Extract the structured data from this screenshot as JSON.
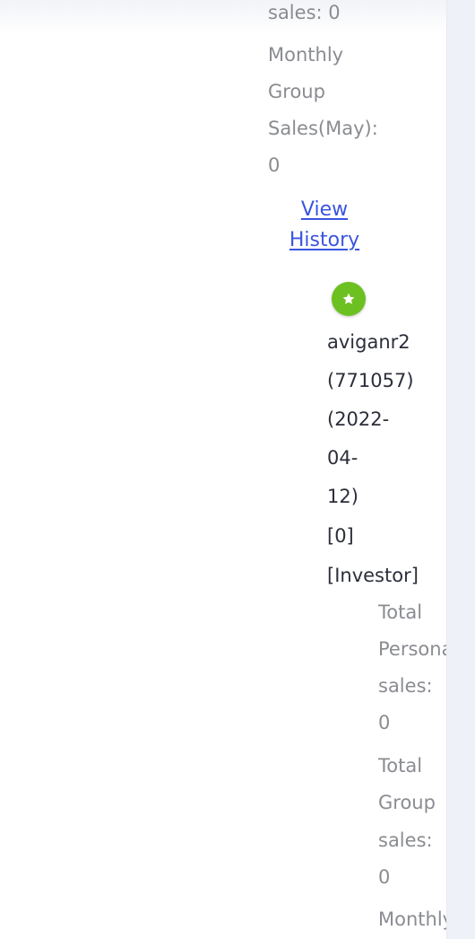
{
  "parent_member": {
    "total_group_sales_tail": "sales: 0",
    "monthly_group_sales_lines": [
      "Monthly",
      "Group",
      "Sales(May):",
      "0"
    ],
    "view_history_lines": [
      "View",
      "History"
    ]
  },
  "child_member": {
    "badge_icon": "star-icon",
    "badge_color": "#6cc020",
    "info_lines": [
      "aviganr2",
      "(771057)",
      "(2022-",
      "04-",
      "12)",
      "[0]",
      "[Investor]"
    ],
    "total_personal_sales_lines": [
      "Total",
      "Personal",
      "sales:",
      "0"
    ],
    "total_group_sales_lines": [
      "Total",
      "Group",
      "sales:",
      "0"
    ],
    "monthly_group_sales_partial": "Monthly"
  },
  "colors": {
    "muted_text": "#8a8c91",
    "dark_text": "#2c2f3a",
    "link": "#3b55e0",
    "scrollbar": "#eef1f7"
  }
}
